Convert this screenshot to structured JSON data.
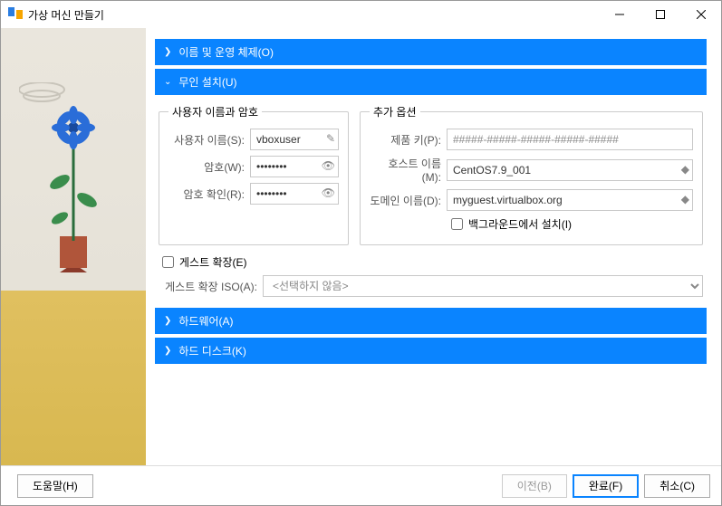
{
  "window": {
    "title": "가상 머신 만들기"
  },
  "sections": {
    "nameOS": {
      "label": "이름 및 운영 체제(O)"
    },
    "unattended": {
      "label": "무인 설치(U)",
      "userpass": {
        "legend": "사용자 이름과 암호",
        "usernameLabel": "사용자 이름(S):",
        "username": "vboxuser",
        "passwordLabel": "암호(W):",
        "password": "••••••••",
        "confirmLabel": "암호 확인(R):",
        "confirm": "••••••••"
      },
      "extra": {
        "legend": "추가 옵션",
        "productKeyLabel": "제품 키(P):",
        "productKeyPlaceholder": "#####-#####-#####-#####-#####",
        "hostnameLabel": "호스트 이름(M):",
        "hostname": "CentOS7.9_001",
        "domainLabel": "도메인 이름(D):",
        "domain": "myguest.virtualbox.org",
        "bgInstallLabel": "백그라운드에서 설치(I)"
      },
      "ga": {
        "checkLabel": "게스트 확장(E)",
        "isoLabel": "게스트 확장 ISO(A):",
        "isoValue": "<선택하지 않음>"
      }
    },
    "hardware": {
      "label": "하드웨어(A)"
    },
    "disk": {
      "label": "하드 디스크(K)"
    }
  },
  "footer": {
    "help": "도움말(H)",
    "back": "이전(B)",
    "finish": "완료(F)",
    "cancel": "취소(C)"
  }
}
